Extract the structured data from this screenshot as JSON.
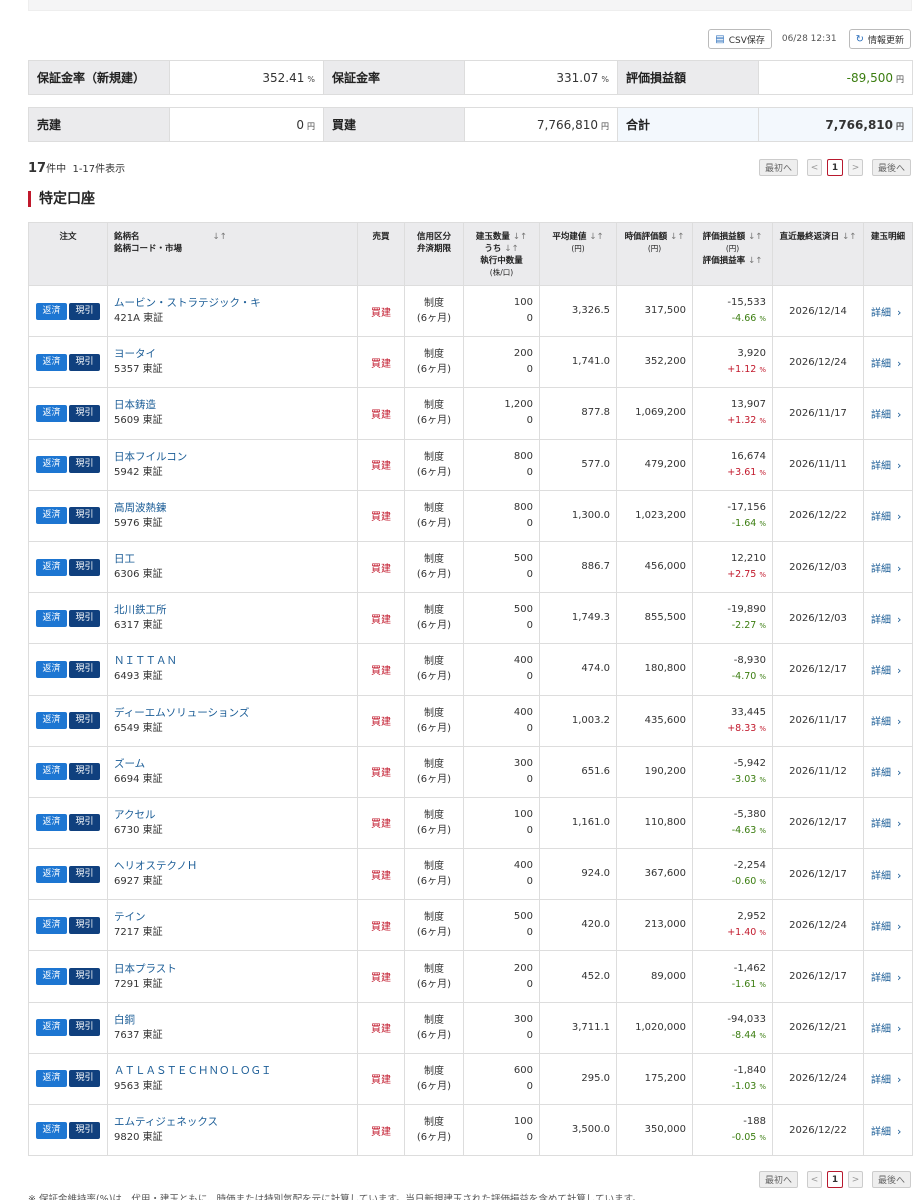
{
  "toolbar": {
    "csv_label": "CSV保存",
    "timestamp": "06/28 12:31",
    "refresh_label": "情報更新"
  },
  "summary": {
    "row1": [
      {
        "label": "保証金率（新規建）",
        "value": "352.41",
        "unit": "%"
      },
      {
        "label": "保証金率",
        "value": "331.07",
        "unit": "%"
      },
      {
        "label": "評価損益額",
        "value": "-89,500",
        "unit": "円"
      }
    ],
    "row2": [
      {
        "label": "売建",
        "value": "0",
        "unit": "円"
      },
      {
        "label": "買建",
        "value": "7,766,810",
        "unit": "円"
      },
      {
        "label": "合計",
        "value": "7,766,810",
        "unit": "円"
      }
    ]
  },
  "count": {
    "total": "17",
    "suffix": "件中",
    "range": "1-17件表示"
  },
  "pager": {
    "first": "最初へ",
    "prev": "<",
    "page": "1",
    "next": ">",
    "last": "最後へ"
  },
  "section_title": "特定口座",
  "headers": {
    "order": "注文",
    "name1": "銘柄名",
    "name2": "銘柄コード・市場",
    "side": "売買",
    "kbn1": "信用区分",
    "kbn2": "弁済期限",
    "qty1": "建玉数量",
    "qty2": "うち",
    "qty3": "執行中数量",
    "qty4": "(株/口)",
    "avg1": "平均建値",
    "avg2": "(円)",
    "val1": "時価評価額",
    "val2": "(円)",
    "pl1": "評価損益額",
    "pl2": "(円)",
    "pl3": "評価損益率",
    "date": "直近最終返済日",
    "detail": "建玉明細",
    "sort": "↓↑"
  },
  "buttons": {
    "henzai": "返済",
    "genbiki": "現引",
    "detail": "詳細",
    "chevron": "›"
  },
  "rows": [
    {
      "name": "ムービン・ストラテジック・キ",
      "code": "421A 東証",
      "side": "買建",
      "kbn": "制度",
      "term": "(6ヶ月)",
      "qty": "100",
      "exec": "0",
      "avg": "3,326.5",
      "val": "317,500",
      "pl": "-15,533",
      "rate": "-4.66",
      "date": "2026/12/14"
    },
    {
      "name": "ヨータイ",
      "code": "5357 東証",
      "side": "買建",
      "kbn": "制度",
      "term": "(6ヶ月)",
      "qty": "200",
      "exec": "0",
      "avg": "1,741.0",
      "val": "352,200",
      "pl": "3,920",
      "rate": "+1.12",
      "date": "2026/12/24"
    },
    {
      "name": "日本鋳造",
      "code": "5609 東証",
      "side": "買建",
      "kbn": "制度",
      "term": "(6ヶ月)",
      "qty": "1,200",
      "exec": "0",
      "avg": "877.8",
      "val": "1,069,200",
      "pl": "13,907",
      "rate": "+1.32",
      "date": "2026/11/17"
    },
    {
      "name": "日本フイルコン",
      "code": "5942 東証",
      "side": "買建",
      "kbn": "制度",
      "term": "(6ヶ月)",
      "qty": "800",
      "exec": "0",
      "avg": "577.0",
      "val": "479,200",
      "pl": "16,674",
      "rate": "+3.61",
      "date": "2026/11/11"
    },
    {
      "name": "高周波熱錬",
      "code": "5976 東証",
      "side": "買建",
      "kbn": "制度",
      "term": "(6ヶ月)",
      "qty": "800",
      "exec": "0",
      "avg": "1,300.0",
      "val": "1,023,200",
      "pl": "-17,156",
      "rate": "-1.64",
      "date": "2026/12/22"
    },
    {
      "name": "日工",
      "code": "6306 東証",
      "side": "買建",
      "kbn": "制度",
      "term": "(6ヶ月)",
      "qty": "500",
      "exec": "0",
      "avg": "886.7",
      "val": "456,000",
      "pl": "12,210",
      "rate": "+2.75",
      "date": "2026/12/03"
    },
    {
      "name": "北川鉄工所",
      "code": "6317 東証",
      "side": "買建",
      "kbn": "制度",
      "term": "(6ヶ月)",
      "qty": "500",
      "exec": "0",
      "avg": "1,749.3",
      "val": "855,500",
      "pl": "-19,890",
      "rate": "-2.27",
      "date": "2026/12/03"
    },
    {
      "name": "ＮＩＴＴＡＮ",
      "code": "6493 東証",
      "side": "買建",
      "kbn": "制度",
      "term": "(6ヶ月)",
      "qty": "400",
      "exec": "0",
      "avg": "474.0",
      "val": "180,800",
      "pl": "-8,930",
      "rate": "-4.70",
      "date": "2026/12/17"
    },
    {
      "name": "ディーエムソリューションズ",
      "code": "6549 東証",
      "side": "買建",
      "kbn": "制度",
      "term": "(6ヶ月)",
      "qty": "400",
      "exec": "0",
      "avg": "1,003.2",
      "val": "435,600",
      "pl": "33,445",
      "rate": "+8.33",
      "date": "2026/11/17"
    },
    {
      "name": "ズーム",
      "code": "6694 東証",
      "side": "買建",
      "kbn": "制度",
      "term": "(6ヶ月)",
      "qty": "300",
      "exec": "0",
      "avg": "651.6",
      "val": "190,200",
      "pl": "-5,942",
      "rate": "-3.03",
      "date": "2026/11/12"
    },
    {
      "name": "アクセル",
      "code": "6730 東証",
      "side": "買建",
      "kbn": "制度",
      "term": "(6ヶ月)",
      "qty": "100",
      "exec": "0",
      "avg": "1,161.0",
      "val": "110,800",
      "pl": "-5,380",
      "rate": "-4.63",
      "date": "2026/12/17"
    },
    {
      "name": "ヘリオステクノＨ",
      "code": "6927 東証",
      "side": "買建",
      "kbn": "制度",
      "term": "(6ヶ月)",
      "qty": "400",
      "exec": "0",
      "avg": "924.0",
      "val": "367,600",
      "pl": "-2,254",
      "rate": "-0.60",
      "date": "2026/12/17"
    },
    {
      "name": "テイン",
      "code": "7217 東証",
      "side": "買建",
      "kbn": "制度",
      "term": "(6ヶ月)",
      "qty": "500",
      "exec": "0",
      "avg": "420.0",
      "val": "213,000",
      "pl": "2,952",
      "rate": "+1.40",
      "date": "2026/12/24"
    },
    {
      "name": "日本プラスト",
      "code": "7291 東証",
      "side": "買建",
      "kbn": "制度",
      "term": "(6ヶ月)",
      "qty": "200",
      "exec": "0",
      "avg": "452.0",
      "val": "89,000",
      "pl": "-1,462",
      "rate": "-1.61",
      "date": "2026/12/17"
    },
    {
      "name": "白銅",
      "code": "7637 東証",
      "side": "買建",
      "kbn": "制度",
      "term": "(6ヶ月)",
      "qty": "300",
      "exec": "0",
      "avg": "3,711.1",
      "val": "1,020,000",
      "pl": "-94,033",
      "rate": "-8.44",
      "date": "2026/12/21"
    },
    {
      "name": "ＡＴＬＡＳＴＥＣＨＮＯＬＯＧＩ",
      "code": "9563 東証",
      "side": "買建",
      "kbn": "制度",
      "term": "(6ヶ月)",
      "qty": "600",
      "exec": "0",
      "avg": "295.0",
      "val": "175,200",
      "pl": "-1,840",
      "rate": "-1.03",
      "date": "2026/12/24"
    },
    {
      "name": "エムティジェネックス",
      "code": "9820 東証",
      "side": "買建",
      "kbn": "制度",
      "term": "(6ヶ月)",
      "qty": "100",
      "exec": "0",
      "avg": "3,500.0",
      "val": "350,000",
      "pl": "-188",
      "rate": "-0.05",
      "date": "2026/12/22"
    }
  ],
  "pct_unit": "%",
  "footnote": "※ 保証金維持率(%)は、代用・建玉ともに、時価または特別気配を元に計算しています。当日新規建玉された評価損益を含めて計算しています。",
  "colors": {
    "accent_red": "#c2192c",
    "gain_green": "#3b7d10",
    "link_blue": "#1a5c96",
    "btn_blue": "#1d76d2",
    "btn_navy": "#10407e"
  }
}
